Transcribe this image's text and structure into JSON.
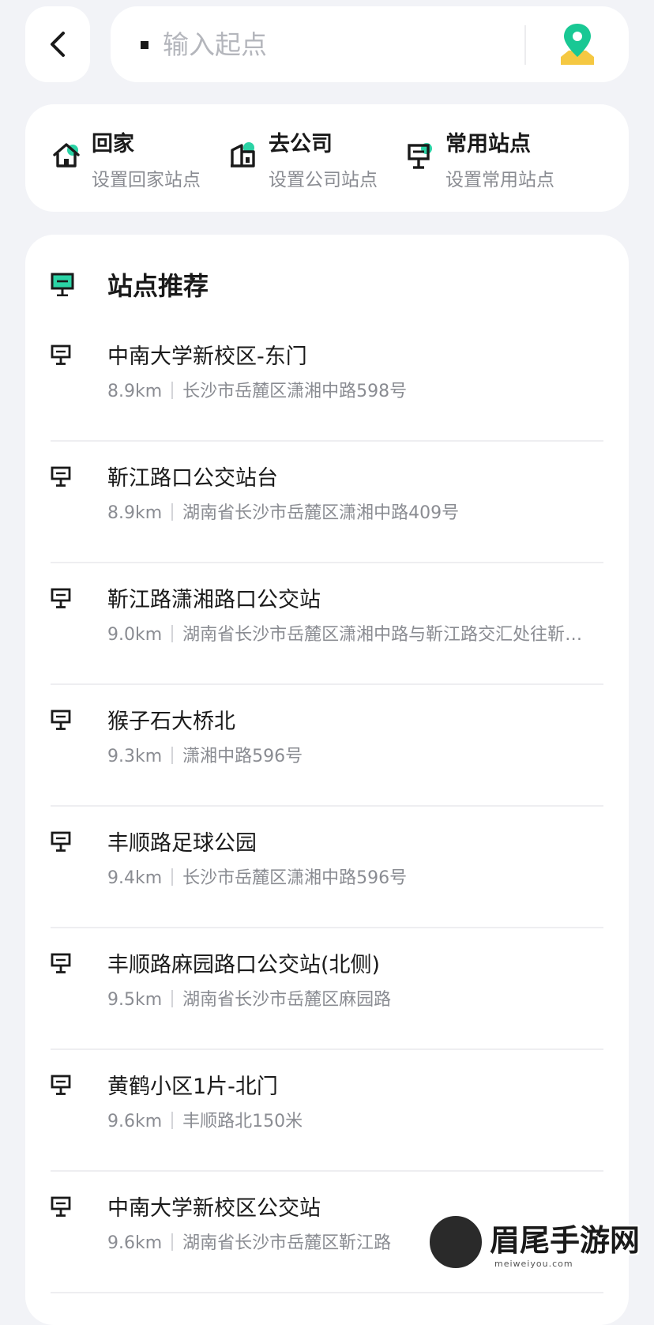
{
  "search": {
    "placeholder": "输入起点"
  },
  "shortcuts": [
    {
      "title": "回家",
      "subtitle": "设置回家站点",
      "icon": "home-icon"
    },
    {
      "title": "去公司",
      "subtitle": "设置公司站点",
      "icon": "office-building-icon"
    },
    {
      "title": "常用站点",
      "subtitle": "设置常用站点",
      "icon": "bus-stop-sign-icon"
    }
  ],
  "recommend": {
    "title": "站点推荐",
    "items": [
      {
        "name": "中南大学新校区-东门",
        "distance": "8.9km",
        "address": "长沙市岳麓区潇湘中路598号"
      },
      {
        "name": "靳江路口公交站台",
        "distance": "8.9km",
        "address": "湖南省长沙市岳麓区潇湘中路409号"
      },
      {
        "name": "靳江路潇湘路口公交站",
        "distance": "9.0km",
        "address": "湖南省长沙市岳麓区潇湘中路与靳江路交汇处往靳…"
      },
      {
        "name": "猴子石大桥北",
        "distance": "9.3km",
        "address": "潇湘中路596号"
      },
      {
        "name": "丰顺路足球公园",
        "distance": "9.4km",
        "address": "长沙市岳麓区潇湘中路596号"
      },
      {
        "name": "丰顺路麻园路口公交站(北侧)",
        "distance": "9.5km",
        "address": "湖南省长沙市岳麓区麻园路"
      },
      {
        "name": "黄鹤小区1片-北门",
        "distance": "9.6km",
        "address": "丰顺路北150米"
      },
      {
        "name": "中南大学新校区公交站",
        "distance": "9.6km",
        "address": "湖南省长沙市岳麓区靳江路"
      }
    ]
  },
  "watermark": {
    "text": "眉尾手游网",
    "sub": "meiweiyou.com"
  },
  "colors": {
    "accent": "#2bd3a5",
    "map_pin": "#19c894",
    "map_base": "#f5c842",
    "bg": "#f2f3f7",
    "card": "#ffffff",
    "text": "#1a1a1a",
    "muted": "#8a8c92"
  }
}
